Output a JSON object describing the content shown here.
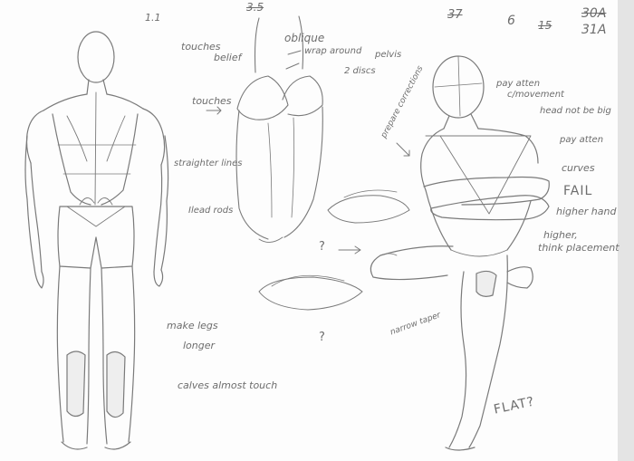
{
  "page": {
    "paper_color": "#fdfdfd",
    "ink_color": "#6d6d6d",
    "shadow_color": "#d9d9d9"
  },
  "annotations": {
    "top_a": "1.1",
    "top_b": "3.5",
    "top_c": "37",
    "top_d": "6",
    "top_e": "15",
    "top_f": "30A",
    "top_g": "31A",
    "touches_a": "touches",
    "belief": "belief",
    "oblique": "oblique",
    "wrap_around": "wrap around",
    "pelvis": "pelvis",
    "discs": "2 discs",
    "touches_b": "touches",
    "straighter_lines": "straighter lines",
    "iliad_rods": "Ilead rods",
    "prepare_corrections": "prepare corrections",
    "pay_attention_1": "pay atten",
    "pay_attention_2": "c/movement",
    "head_not_big": "head not be big",
    "pay_atten_2": "pay atten",
    "curves": "curves",
    "fail": "FAIL",
    "higher_hand": "higher hand",
    "higher_2": "higher,",
    "think_placement": "think placement",
    "q1": "?",
    "q2": "?",
    "make_legs_longer_1": "make legs",
    "make_legs_longer_2": "longer",
    "calves_almost_touch": "calves almost touch",
    "narrow_taper": "narrow taper",
    "flat": "FLAT?"
  }
}
